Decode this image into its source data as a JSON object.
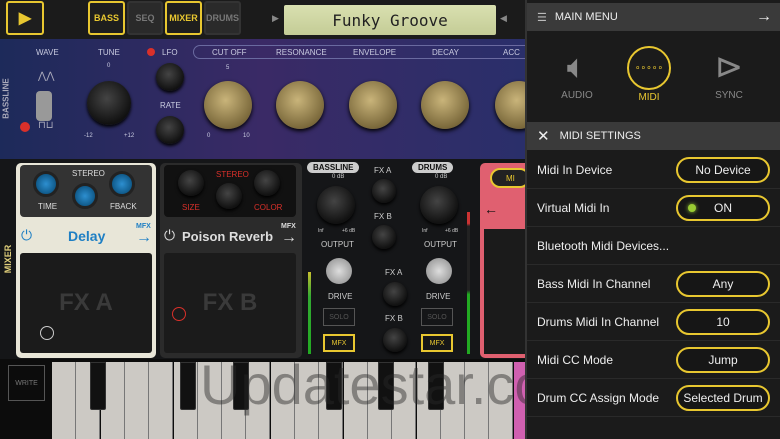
{
  "toolbar": {
    "play_icon": "play",
    "tabs": [
      "BASS",
      "SEQ",
      "MIXER",
      "DRUMS"
    ],
    "preset_name": "Funky Groove"
  },
  "bassline": {
    "section_label": "BASSLINE",
    "wave": "WAVE",
    "tune": "TUNE",
    "tune_zero": "0",
    "tune_min": "-12",
    "tune_max": "+12",
    "lfo": "LFO",
    "rate": "RATE",
    "knobs": [
      "CUT OFF",
      "RESONANCE",
      "ENVELOPE",
      "DECAY",
      "ACC"
    ],
    "scale_min": "0",
    "scale_mid": "5",
    "scale_max": "10"
  },
  "mixer": {
    "section_label": "MIXER",
    "fx_a": {
      "stereo": "STEREO",
      "time": "TIME",
      "fback": "FBACK",
      "name": "Delay",
      "mfx": "MFX",
      "pad": "FX A"
    },
    "fx_b": {
      "stereo": "STEREO",
      "size": "SIZE",
      "color": "COLOR",
      "name": "Poison Reverb",
      "mfx": "MFX",
      "pad": "FX B"
    },
    "channels": [
      {
        "name": "BASSLINE",
        "db": "0 dB",
        "inf": "Inf",
        "plus": "+6 dB",
        "output": "OUTPUT",
        "drive": "DRIVE",
        "solo": "SOLO",
        "mfx": "MFX"
      },
      {
        "name": "DRUMS",
        "db": "0 dB",
        "inf": "Inf",
        "plus": "+6 dB",
        "output": "OUTPUT",
        "drive": "DRIVE",
        "solo": "SOLO",
        "mfx": "MFX"
      }
    ],
    "sends": [
      "FX A",
      "FX B",
      "FX A",
      "FX B"
    ],
    "partial": "MI"
  },
  "keyboard": {
    "write": "WRITE"
  },
  "watermark": "Updatestar.co",
  "menu": {
    "title": "MAIN MENU",
    "icons": [
      {
        "label": "AUDIO",
        "active": false
      },
      {
        "label": "MIDI",
        "active": true
      },
      {
        "label": "SYNC",
        "active": false
      }
    ],
    "settings_title": "MIDI SETTINGS",
    "rows": [
      {
        "label": "Midi In Device",
        "value": "No Device"
      },
      {
        "label": "Virtual Midi In",
        "value": "ON"
      },
      {
        "label": "Bluetooth Midi Devices...",
        "value": null
      },
      {
        "label": "Bass Midi In Channel",
        "value": "Any"
      },
      {
        "label": "Drums Midi In Channel",
        "value": "10"
      },
      {
        "label": "Midi CC Mode",
        "value": "Jump"
      },
      {
        "label": "Drum CC Assign Mode",
        "value": "Selected Drum"
      }
    ]
  },
  "colors": {
    "accent": "#e8c730",
    "fx_blue": "#1e7fc4",
    "red": "#d9302a"
  }
}
